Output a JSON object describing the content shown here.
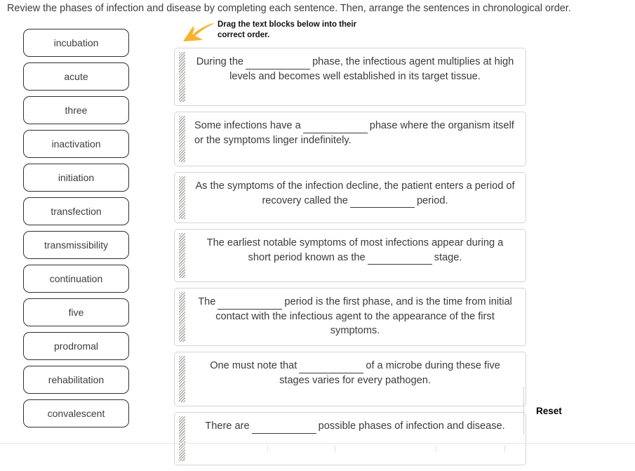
{
  "prompt": "Review the phases of infection and disease by completing each sentence. Then, arrange the sentences in chronological order.",
  "drag_hint": "Drag the text blocks below into their correct order.",
  "arrow": {
    "icon": "arrow-down-left-icon",
    "color": "#f5b324"
  },
  "wordbank": {
    "items": [
      {
        "label": "incubation"
      },
      {
        "label": "acute"
      },
      {
        "label": "three"
      },
      {
        "label": "inactivation"
      },
      {
        "label": "initiation"
      },
      {
        "label": "transfection"
      },
      {
        "label": "transmissibility"
      },
      {
        "label": "continuation"
      },
      {
        "label": "five"
      },
      {
        "label": "prodromal"
      },
      {
        "label": "rehabilitation"
      },
      {
        "label": "convalescent"
      }
    ]
  },
  "blocks": [
    {
      "handle": "drag-handle-icon",
      "align": "center",
      "height_class": "h-83",
      "part1": "During the",
      "part2": "phase, the infectious agent multiplies at high levels and becomes well established in its target tissue."
    },
    {
      "handle": "drag-handle-icon",
      "align": "left",
      "height_class": "h-78",
      "part1": "Some infections have a",
      "part2": "phase where the organism itself or the symptoms linger indefinitely."
    },
    {
      "handle": "drag-handle-icon",
      "align": "center",
      "height_class": "h-73",
      "part1": "As the symptoms of the infection decline, the patient enters a period of recovery called the",
      "part2": "period."
    },
    {
      "handle": "drag-handle-icon",
      "align": "center",
      "height_class": "h-76",
      "part1": "The earliest notable symptoms of most infections appear during a short period known as the",
      "part2": "stage."
    },
    {
      "handle": "drag-handle-icon",
      "align": "center",
      "height_class": "h-83",
      "part1": "The",
      "part2": "period is the first phase, and is the time from initial contact with the infectious agent to the appearance of the first symptoms."
    },
    {
      "handle": "drag-handle-icon",
      "align": "center",
      "height_class": "h-78",
      "part1": "One must note that",
      "part2": "of a microbe during these five stages varies for every pathogen."
    },
    {
      "handle": "drag-handle-icon",
      "align": "center",
      "height_class": "h-76",
      "part1": "There are",
      "part2": "possible phases of infection and disease."
    }
  ],
  "reset": {
    "label": "Reset"
  },
  "footer": {
    "tick_positions": [
      381,
      477,
      621,
      719
    ]
  }
}
